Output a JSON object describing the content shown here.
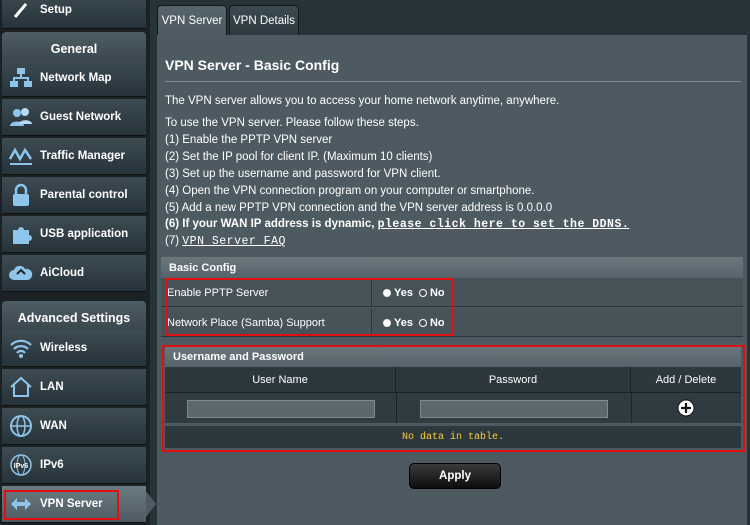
{
  "sidebar": {
    "top_item": "Setup",
    "general_header": "General",
    "general_items": [
      {
        "label": "Network Map",
        "icon": "network-map-icon"
      },
      {
        "label": "Guest Network",
        "icon": "guest-network-icon"
      },
      {
        "label": "Traffic Manager",
        "icon": "traffic-manager-icon"
      },
      {
        "label": "Parental control",
        "icon": "lock-icon"
      },
      {
        "label": "USB application",
        "icon": "puzzle-icon"
      },
      {
        "label": "AiCloud",
        "icon": "cloud-icon"
      }
    ],
    "advanced_header": "Advanced Settings",
    "advanced_items": [
      {
        "label": "Wireless",
        "icon": "wifi-icon"
      },
      {
        "label": "LAN",
        "icon": "home-icon"
      },
      {
        "label": "WAN",
        "icon": "globe-icon"
      },
      {
        "label": "IPv6",
        "icon": "ipv6-icon"
      },
      {
        "label": "VPN Server",
        "icon": "vpn-icon",
        "active": true
      }
    ]
  },
  "tabs": [
    {
      "label": "VPN Server",
      "active": true
    },
    {
      "label": "VPN Details",
      "active": false
    }
  ],
  "main": {
    "title": "VPN Server - Basic Config",
    "intro": "The VPN server allows you to access your home network anytime, anywhere.",
    "steps_intro": "To use the VPN server. Please follow these steps.",
    "steps": [
      "(1) Enable the PPTP VPN server",
      "(2) Set the IP pool for client IP. (Maximum 10 clients)",
      "(3) Set up the username and password for VPN client.",
      "(4) Open the VPN connection program on your computer or smartphone.",
      "(5) Add a new PPTP VPN connection and the VPN server address is 0.0.0.0"
    ],
    "step6_prefix": "(6) If your WAN IP address is dynamic,",
    "step6_link": "please click here to set the DDNS.",
    "step7_prefix": "(7)",
    "step7_link": "VPN Server FAQ"
  },
  "basic_config": {
    "header": "Basic Config",
    "rows": [
      {
        "label": "Enable PPTP Server",
        "yes": "Yes",
        "no": "No",
        "selected": "Yes"
      },
      {
        "label": "Network Place (Samba) Support",
        "yes": "Yes",
        "no": "No",
        "selected": "Yes"
      }
    ]
  },
  "users": {
    "header": "Username and Password",
    "columns": [
      "User Name",
      "Password",
      "Add / Delete"
    ],
    "username_value": "",
    "password_value": "",
    "empty_message": "No data in table."
  },
  "apply_label": "Apply",
  "colors": {
    "highlight": "#e01010",
    "no_data_text": "#ffcc33"
  }
}
